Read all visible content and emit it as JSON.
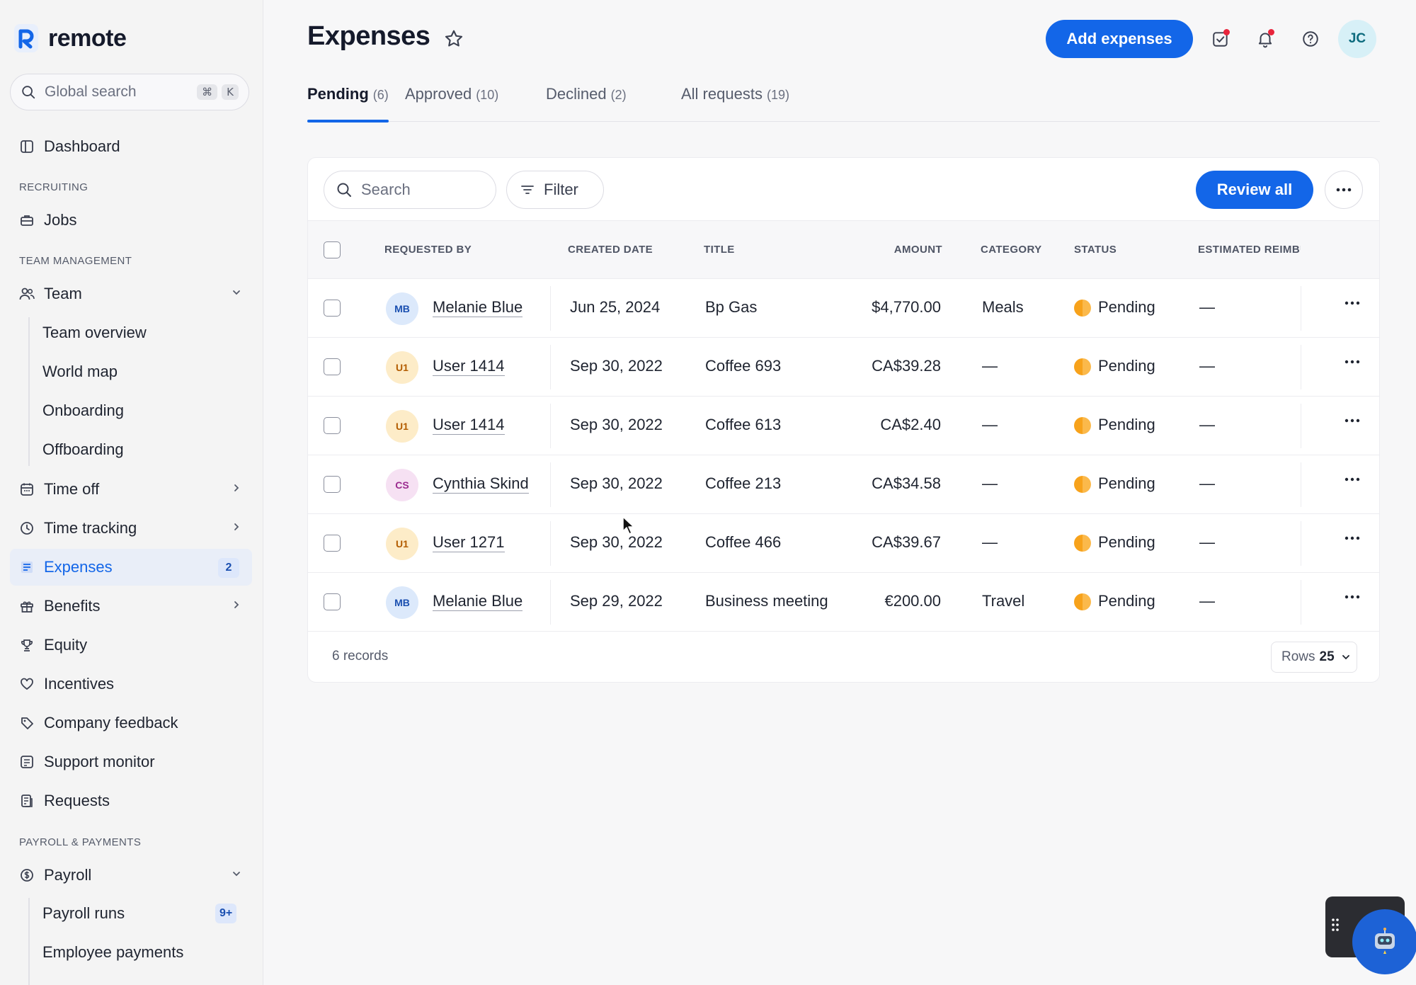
{
  "app": {
    "name": "remote"
  },
  "sidebar": {
    "search_placeholder": "Global search",
    "shortcut_keys": [
      "⌘",
      "K"
    ],
    "dashboard": "Dashboard",
    "section_recruiting": "RECRUITING",
    "jobs": "Jobs",
    "section_team": "TEAM MANAGEMENT",
    "team": "Team",
    "team_children": [
      "Team overview",
      "World map",
      "Onboarding",
      "Offboarding"
    ],
    "time_off": "Time off",
    "time_tracking": "Time tracking",
    "expenses": "Expenses",
    "expenses_badge": "2",
    "benefits": "Benefits",
    "equity": "Equity",
    "incentives": "Incentives",
    "company_feedback": "Company feedback",
    "support_monitor": "Support monitor",
    "requests": "Requests",
    "section_payroll": "PAYROLL & PAYMENTS",
    "payroll": "Payroll",
    "payroll_runs": "Payroll runs",
    "payroll_runs_badge": "9+",
    "employee_payments": "Employee payments"
  },
  "header": {
    "title": "Expenses",
    "add_button": "Add expenses",
    "user_initials": "JC",
    "accent_color": "#1366e8"
  },
  "tabs": [
    {
      "label": "Pending",
      "count": "(6)",
      "active": true
    },
    {
      "label": "Approved",
      "count": "(10)"
    },
    {
      "label": "Declined",
      "count": "(2)"
    },
    {
      "label": "All requests",
      "count": "(19)"
    }
  ],
  "toolbar": {
    "search_placeholder": "Search",
    "filter_label": "Filter",
    "review_all": "Review all"
  },
  "table": {
    "columns": [
      "REQUESTED BY",
      "CREATED DATE",
      "TITLE",
      "AMOUNT",
      "CATEGORY",
      "STATUS",
      "ESTIMATED REIMBU"
    ],
    "rows": [
      {
        "initials": "MB",
        "name": "Melanie Blue",
        "date": "Jun 25, 2024",
        "title": "Bp Gas",
        "amount": "$4,770.00",
        "category": "Meals",
        "status": "Pending",
        "estimated": "—"
      },
      {
        "initials": "U1",
        "name": "User 1414",
        "date": "Sep 30, 2022",
        "title": "Coffee 693",
        "amount": "CA$39.28",
        "category": "—",
        "status": "Pending",
        "estimated": "—"
      },
      {
        "initials": "U1",
        "name": "User 1414",
        "date": "Sep 30, 2022",
        "title": "Coffee 613",
        "amount": "CA$2.40",
        "category": "—",
        "status": "Pending",
        "estimated": "—"
      },
      {
        "initials": "CS",
        "name": "Cynthia Skind",
        "date": "Sep 30, 2022",
        "title": "Coffee 213",
        "amount": "CA$34.58",
        "category": "—",
        "status": "Pending",
        "estimated": "—"
      },
      {
        "initials": "U1",
        "name": "User 1271",
        "date": "Sep 30, 2022",
        "title": "Coffee 466",
        "amount": "CA$39.67",
        "category": "—",
        "status": "Pending",
        "estimated": "—"
      },
      {
        "initials": "MB",
        "name": "Melanie Blue",
        "date": "Sep 29, 2022",
        "title": "Business meeting",
        "amount": "€200.00",
        "category": "Travel",
        "status": "Pending",
        "estimated": "—"
      }
    ],
    "records_label": "6 records",
    "rows_label": "Rows",
    "rows_value": "25"
  }
}
